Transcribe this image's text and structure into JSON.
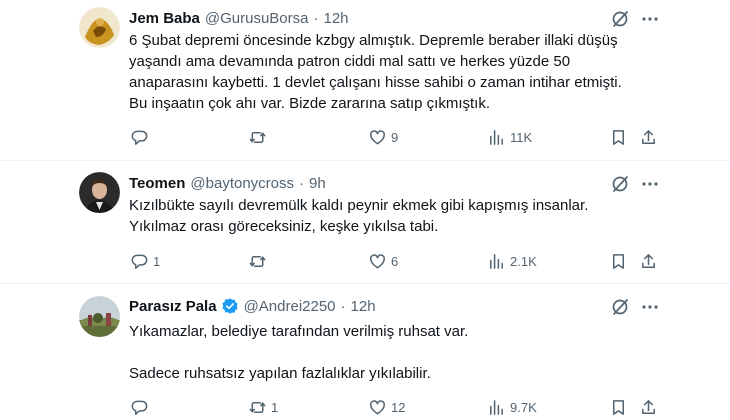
{
  "tweets": [
    {
      "name": "Jem Baba",
      "handle": "@GurusuBorsa",
      "dot": "·",
      "time": "12h",
      "verified": false,
      "lines": [
        "6 Şubat depremi öncesinde kzbgy almıştık. Depremle beraber illaki düşüş",
        "yaşandı ama devamında patron ciddi mal sattı ve herkes yüzde 50",
        "anaparasını kaybetti. 1 devlet çalışanı hisse sahibi o zaman intihar etmişti.",
        "Bu inşaatın çok ahı var. Bizde zararına satıp çıkmıştık."
      ],
      "replies": "",
      "retweets": "",
      "likes": "9",
      "views": "11K"
    },
    {
      "name": "Teomen",
      "handle": "@baytonycross",
      "dot": "·",
      "time": "9h",
      "verified": false,
      "lines": [
        "Kızılbükte sayılı devremülk kaldı peynir ekmek gibi kapışmış insanlar.",
        "Yıkılmaz orası göreceksiniz, keşke yıkılsa tabi."
      ],
      "replies": "1",
      "retweets": "",
      "likes": "6",
      "views": "2.1K"
    },
    {
      "name": "Parasız Pala",
      "handle": "@Andrei2250",
      "dot": "·",
      "time": "12h",
      "verified": true,
      "lines": [
        "Yıkamazlar, belediye tarafından verilmiş ruhsat var.",
        "",
        "Sadece ruhsatsız yapılan fazlalıklar yıkılabilir."
      ],
      "replies": "",
      "retweets": "1",
      "likes": "12",
      "views": "9.7K"
    }
  ],
  "icons": {
    "reply": "reply-icon",
    "retweet": "retweet-icon",
    "like": "heart-icon",
    "views": "views-icon",
    "bookmark": "bookmark-icon",
    "share": "share-icon",
    "grok": "grok-icon",
    "more": "more-icon",
    "verified": "verified-badge-icon"
  },
  "colors": {
    "text": "#0f1419",
    "secondary": "#536471",
    "verified": "#1d9bf0",
    "divider": "#eff3f4"
  }
}
